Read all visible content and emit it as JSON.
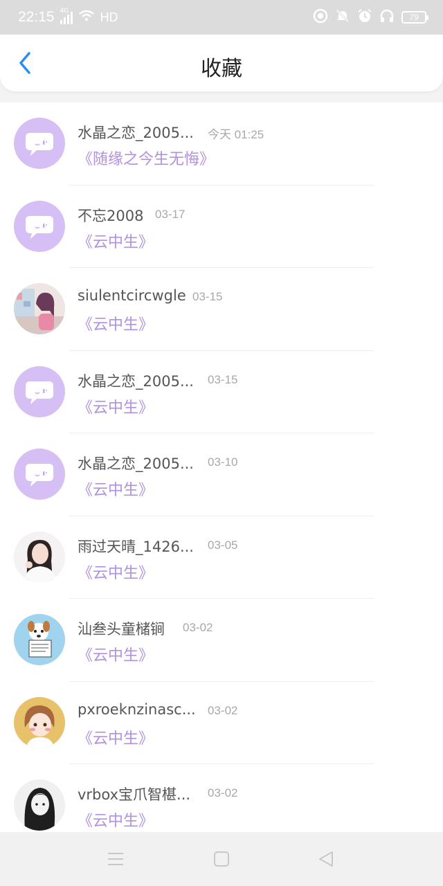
{
  "status_bar": {
    "time": "22:15",
    "network": "4G",
    "hd_label": "HD",
    "battery": "79",
    "icons": [
      "signal-icon",
      "wifi-icon",
      "camera-record-icon",
      "mute-icon",
      "alarm-icon",
      "headphones-icon",
      "battery-icon"
    ]
  },
  "header": {
    "title": "收藏",
    "back_icon": "chevron-left-icon"
  },
  "colors": {
    "accent_blue": "#2a8ef0",
    "book_purple": "#b290e0",
    "avatar_default": "#d6bff4"
  },
  "favorites": [
    {
      "name": "水晶之恋_2005...",
      "time": "今天 01:25",
      "book": "《随缘之今生无悔》",
      "avatar": "default-chat-avatar"
    },
    {
      "name": "不忘2008",
      "time": "03-17",
      "book": "《云中生》",
      "avatar": "default-chat-avatar"
    },
    {
      "name": "siulentcircwgle",
      "time": "03-15",
      "book": "《云中生》",
      "avatar": "anime-girl-avatar"
    },
    {
      "name": "水晶之恋_2005...",
      "time": "03-15",
      "book": "《云中生》",
      "avatar": "default-chat-avatar"
    },
    {
      "name": "水晶之恋_2005...",
      "time": "03-10",
      "book": "《云中生》",
      "avatar": "default-chat-avatar"
    },
    {
      "name": "雨过天晴_1426...",
      "time": "03-05",
      "book": "《云中生》",
      "avatar": "woman-photo-avatar"
    },
    {
      "name": "汕叁头童槠锏",
      "time": "03-02",
      "book": "《云中生》",
      "avatar": "cartoon-dog-avatar"
    },
    {
      "name": "pxroeknzinasc...",
      "time": "03-02",
      "book": "《云中生》",
      "avatar": "cartoon-girl-avatar"
    },
    {
      "name": "vrbox宝爪智椹...",
      "time": "03-02",
      "book": "《云中生》",
      "avatar": "bw-girl-photo-avatar"
    }
  ],
  "bottom_nav": {
    "icons": [
      "menu-icon",
      "home-square-icon",
      "back-triangle-icon"
    ]
  }
}
